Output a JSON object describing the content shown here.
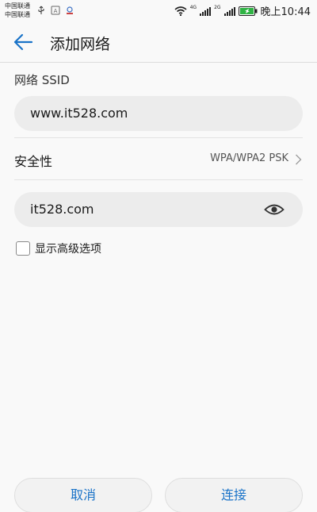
{
  "status_bar": {
    "carrier_1": "中国联通",
    "carrier_2": "中国联通",
    "network_1": "4G",
    "network_2": "2G",
    "time": "晚上10:44",
    "icons": [
      "usb-icon",
      "notification-icon",
      "app-icon",
      "wifi-icon",
      "signal-icon",
      "battery-icon"
    ]
  },
  "app_bar": {
    "title": "添加网络",
    "back_icon": "arrow-left-icon"
  },
  "form": {
    "ssid_label": "网络 SSID",
    "ssid_value": "www.it528.com",
    "security_label": "安全性",
    "security_value": "WPA/WPA2 PSK",
    "password_value": "it528.com",
    "advanced_label": "显示高级选项",
    "advanced_checked": false
  },
  "buttons": {
    "cancel": "取消",
    "connect": "连接"
  },
  "colors": {
    "accent": "#1a73c8",
    "field_bg": "#ececec",
    "page_bg": "#f9f9f9"
  }
}
